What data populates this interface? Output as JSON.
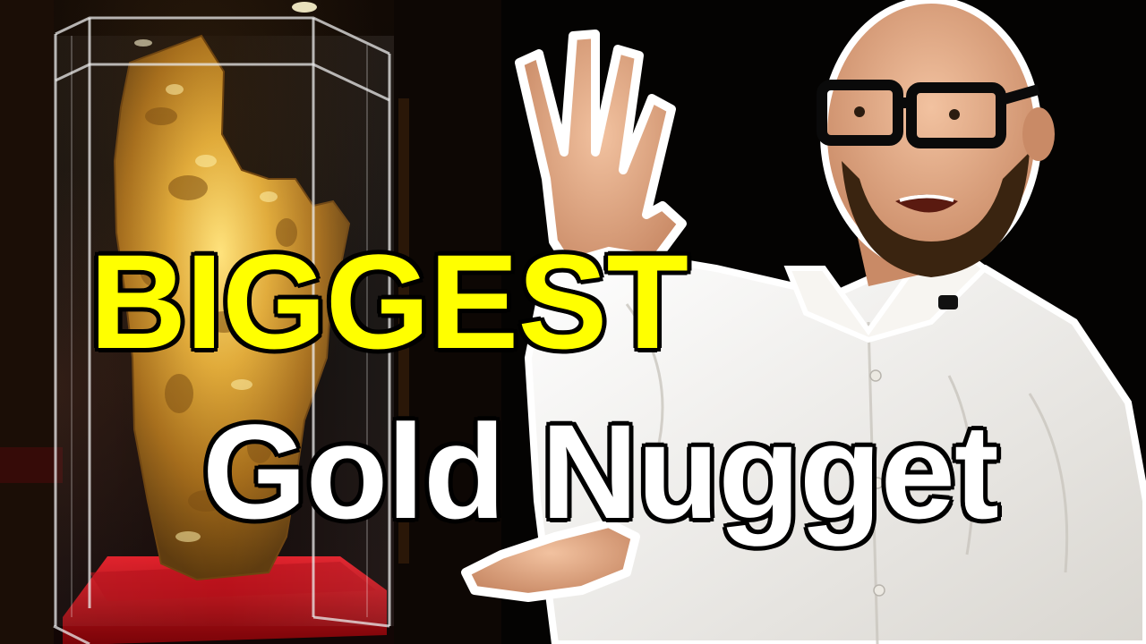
{
  "thumbnail": {
    "title_line_1": "BIGGEST",
    "title_line_2": "Gold Nugget",
    "colors": {
      "title_line_1": "#ffff00",
      "title_line_2": "#ffffff",
      "outline": "#000000",
      "gold": "#d9a430",
      "velvet": "#c8101a",
      "shirt": "#f4f2ee"
    },
    "scene": {
      "left": "gold-nugget-in-display-case",
      "right": "presenter-gesturing-icon"
    }
  }
}
